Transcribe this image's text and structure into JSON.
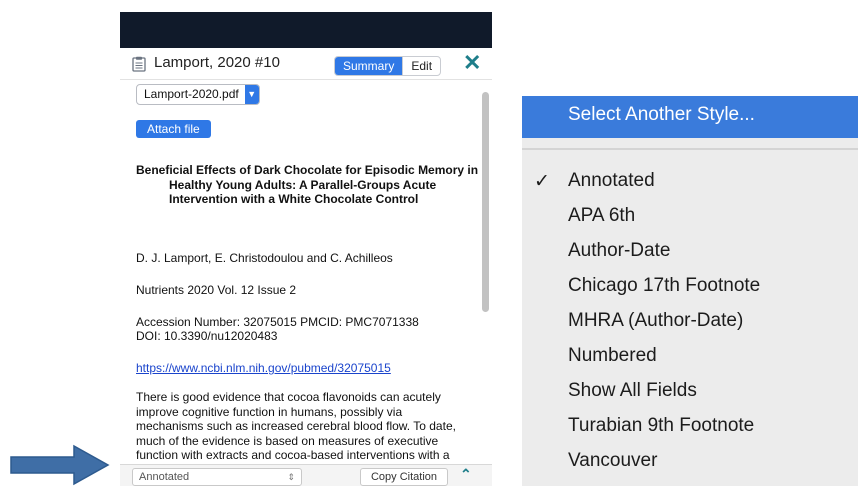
{
  "reference_panel": {
    "header_title": "Lamport, 2020 #10",
    "segments": [
      "Summary",
      "Edit"
    ],
    "close_symbol": "✕",
    "pdf_file": "Lamport-2020.pdf",
    "attach_label": "Attach file",
    "reference": {
      "title": "Beneficial Effects of Dark Chocolate for Episodic Memory in Healthy Young Adults: A Parallel-Groups Acute Intervention with a White Chocolate Control",
      "authors": "D. J. Lamport, E. Christodoulou and C. Achilleos",
      "journal": "Nutrients 2020 Vol. 12 Issue 2",
      "accession": "Accession Number: 32075015 PMCID: PMC7071338",
      "doi": "DOI: 10.3390/nu12020483",
      "url": "https://www.ncbi.nlm.nih.gov/pubmed/32075015",
      "abstract": "There is good evidence that cocoa flavonoids can acutely improve cognitive function in humans, possibly via mechanisms such as increased cerebral blood flow. To date, much of the evidence is based on measures of executive function with extracts and cocoa-based interventions with a high flavonoid content. The aim of the"
    },
    "bottom_bar": {
      "style_value": "Annotated",
      "copy_label": "Copy Citation"
    },
    "icons": {
      "document": "clipboard-document-icon",
      "collapse": "chevron-up-icon"
    }
  },
  "style_menu": {
    "header_item": "Select Another Style...",
    "checkmark": "✓",
    "selected": "Annotated",
    "items": [
      "Annotated",
      "APA 6th",
      "Author-Date",
      "Chicago 17th Footnote",
      "MHRA (Author-Date)",
      "Numbered",
      "Show All Fields",
      "Turabian 9th Footnote",
      "Vancouver"
    ]
  },
  "colors": {
    "accent": "#2f78e6",
    "menu_highlight": "#3a7bdb",
    "teal": "#1e7e8a",
    "arrow": "#3f6ea6",
    "title_bar": "#101a2a"
  }
}
